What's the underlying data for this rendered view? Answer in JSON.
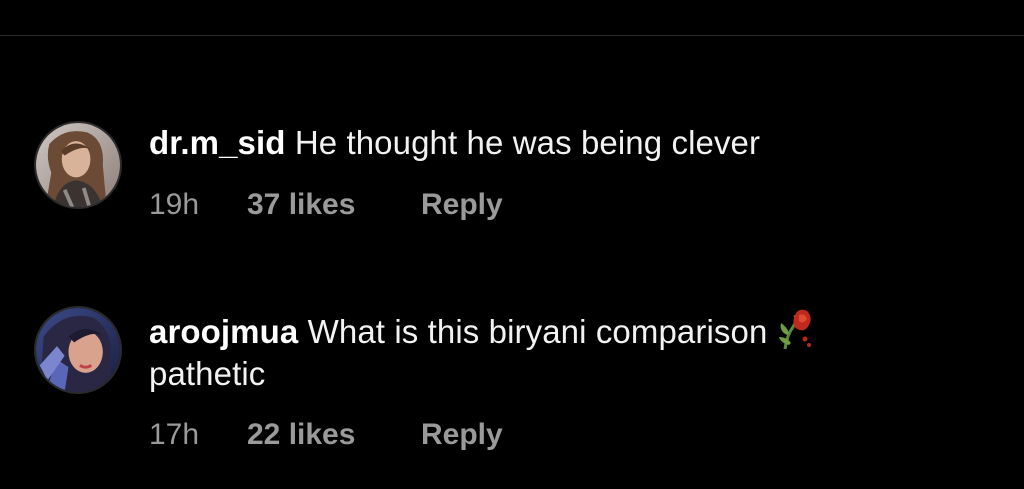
{
  "comments": [
    {
      "username": "dr.m_sid",
      "text": "He thought he was being clever",
      "time": "19h",
      "likes": "37 likes",
      "reply_label": "Reply",
      "emoji": ""
    },
    {
      "username": "aroojmua",
      "text": "What is this biryani comparison",
      "text_line2": "pathetic",
      "time": "17h",
      "likes": "22 likes",
      "reply_label": "Reply",
      "emoji": "wilted-rose-icon"
    }
  ],
  "colors": {
    "background": "#000000",
    "text": "#f2f2f2",
    "meta": "#9a9a9a"
  }
}
